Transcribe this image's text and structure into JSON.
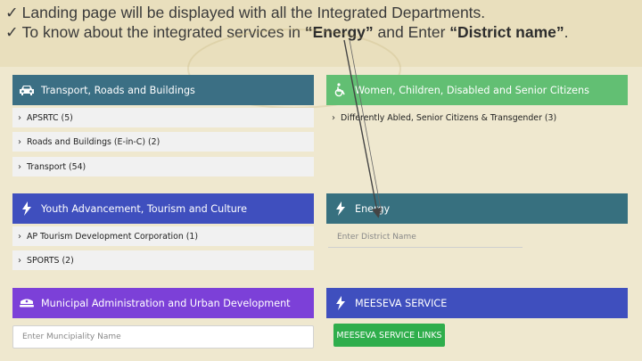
{
  "instructions": {
    "check_mark": "✓",
    "line1": "Landing page will be displayed with all the Integrated Departments.",
    "line2_prefix": "To know about the integrated services in ",
    "line2_energy": "“Energy”",
    "line2_middle": " and Enter ",
    "line2_district": "“District name”",
    "line2_suffix": "."
  },
  "departments": {
    "transport": {
      "title": "Transport, Roads and Buildings",
      "icon": "car-icon",
      "color": "#3b6f84",
      "items": [
        "APSRTC (5)",
        "Roads and Buildings (E-in-C) (2)",
        "Transport (54)"
      ]
    },
    "women": {
      "title": "Women, Children, Disabled and Senior Citizens",
      "icon": "wheelchair-icon",
      "color": "#62bf73",
      "items": [
        "Differently Abled, Senior Citizens & Transgender (3)"
      ]
    },
    "youth": {
      "title": "Youth Advancement, Tourism and Culture",
      "icon": "lightning-icon",
      "color": "#3f4fbe",
      "items": [
        "AP Tourism Development Corporation (1)",
        "SPORTS (2)"
      ]
    },
    "energy": {
      "title": "Energy",
      "icon": "lightning-icon",
      "color": "#37707f",
      "district_placeholder": "Enter District Name"
    },
    "municipal": {
      "title": "Municipal Administration and Urban Development",
      "icon": "police-cap-icon",
      "color": "#7c40d8",
      "municipality_placeholder": "Enter Muncipiality Name"
    },
    "meeseva": {
      "title": "MEESEVA SERVICE",
      "icon": "lightning-icon",
      "color": "#3f4fbe",
      "button_label": "MEESEVA SERVICE LINKS"
    }
  }
}
